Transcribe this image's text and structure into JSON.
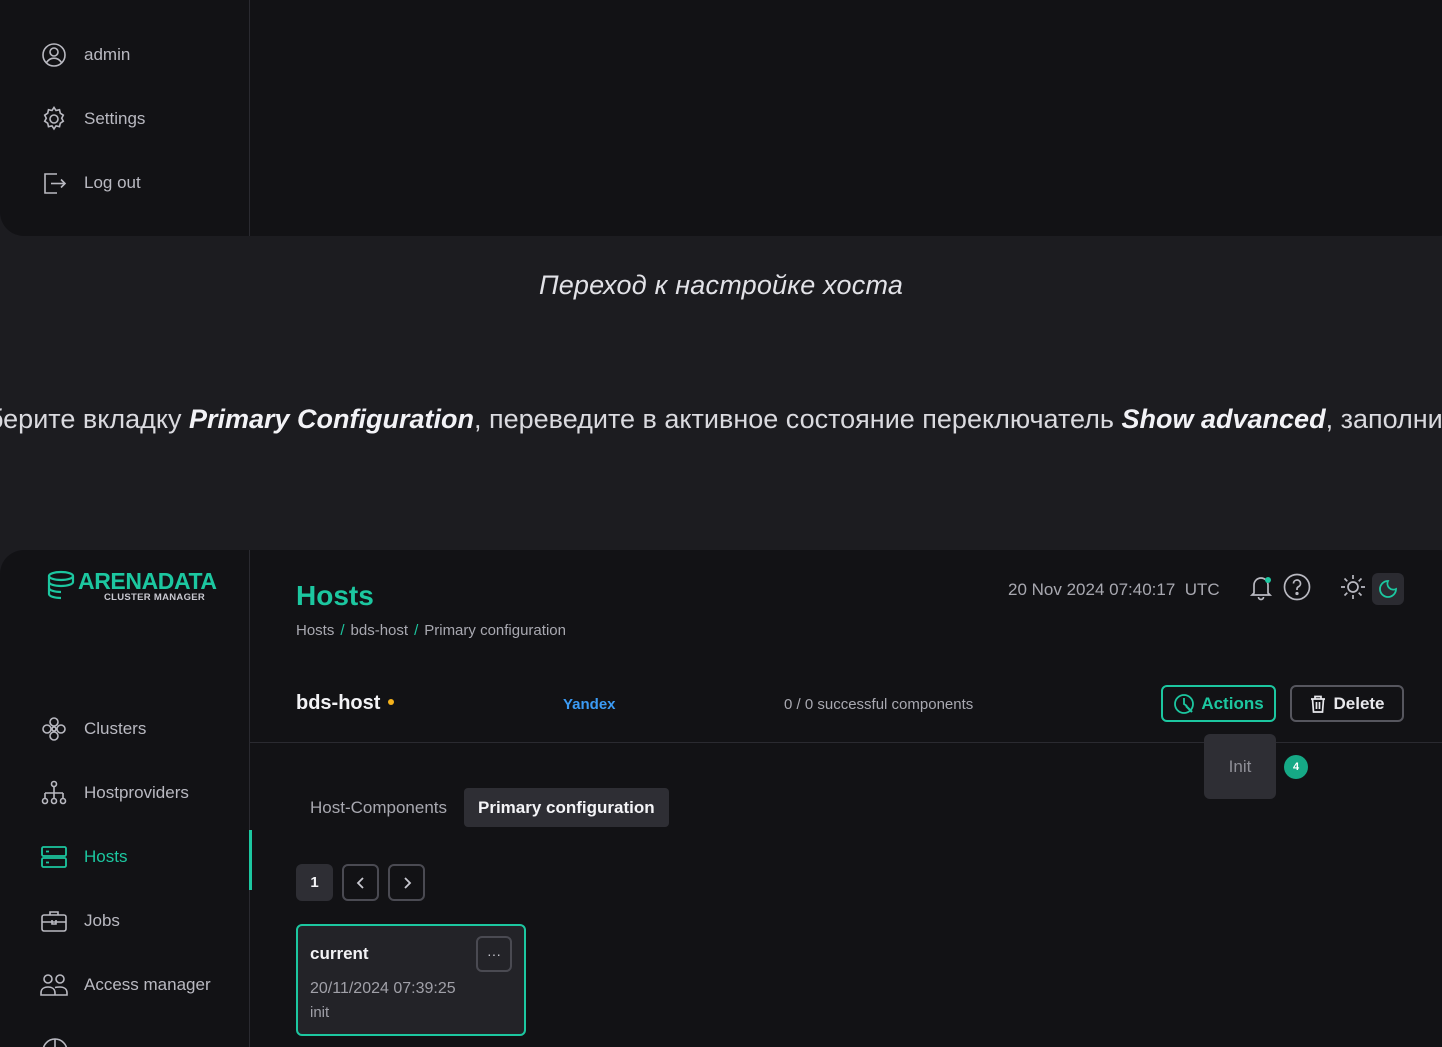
{
  "top_sidebar": {
    "items": [
      {
        "label": "admin",
        "icon": "user-circle-icon"
      },
      {
        "label": "Settings",
        "icon": "gear-icon"
      },
      {
        "label": "Log out",
        "icon": "logout-icon"
      }
    ]
  },
  "caption": "Переход к настройке хоста",
  "paragraph": {
    "part1": "берите вкладку ",
    "bold1": "Primary Configuration",
    "part2": ", переведите в активное состояние переключатель ",
    "bold2": "Show advanced",
    "part3": ", заполнит"
  },
  "logo": {
    "main": "ARENADATA",
    "sub": "CLUSTER MANAGER"
  },
  "sidebar": {
    "items": [
      {
        "label": "Clusters",
        "icon": "clusters-icon"
      },
      {
        "label": "Hostproviders",
        "icon": "hierarchy-icon"
      },
      {
        "label": "Hosts",
        "icon": "server-icon",
        "active": true
      },
      {
        "label": "Jobs",
        "icon": "briefcase-icon"
      },
      {
        "label": "Access manager",
        "icon": "users-icon"
      }
    ]
  },
  "header": {
    "title": "Hosts",
    "breadcrumb": [
      "Hosts",
      "bds-host",
      "Primary configuration"
    ],
    "datetime": "20 Nov 2024 07:40:17  UTC"
  },
  "host": {
    "name": "bds-host",
    "provider": "Yandex",
    "components": "0 / 0 successful components",
    "status_color": "#f5b21b"
  },
  "buttons": {
    "actions": "Actions",
    "delete": "Delete"
  },
  "actions_menu": {
    "items": [
      "Init"
    ],
    "badge": "4"
  },
  "tabs": [
    {
      "label": "Host-Components",
      "active": false
    },
    {
      "label": "Primary configuration",
      "active": true
    }
  ],
  "pager": {
    "current": "1"
  },
  "config_card": {
    "title": "current",
    "date": "20/11/2024 07:39:25",
    "description": "init",
    "menu": "···"
  },
  "colors": {
    "accent": "#1cc7a0",
    "provider": "#3b9bf5",
    "background": "#121215"
  }
}
